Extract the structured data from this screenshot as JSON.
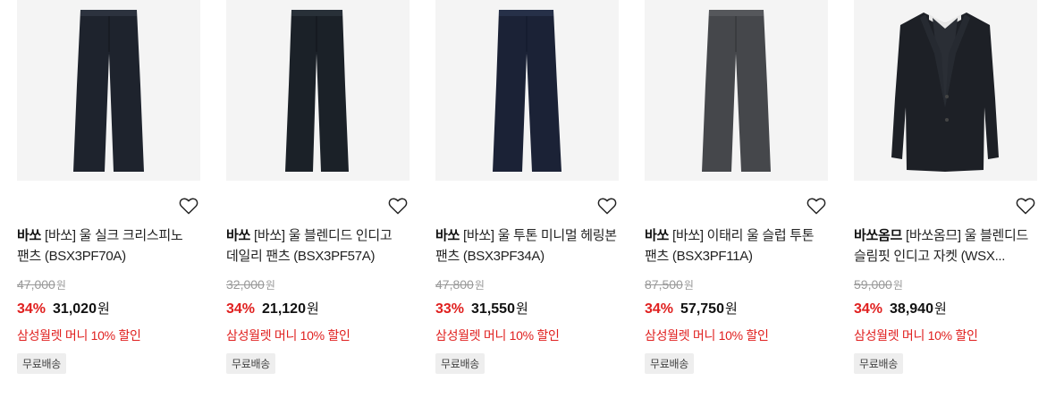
{
  "products": [
    {
      "brand": "바쏘",
      "name": "[바쏘] 울 실크 크리스피노 팬츠 (BSX3PF70A)",
      "original_price": "47,000",
      "discount_rate": "34%",
      "sale_price": "31,020",
      "currency": "원",
      "promo": "삼성월렛 머니 10% 할인",
      "badge": "무료배송",
      "image": "pants",
      "garment_color": "#1e232d"
    },
    {
      "brand": "바쏘",
      "name": "[바쏘] 울 블렌디드 인디고 데일리 팬츠 (BSX3PF57A)",
      "original_price": "32,000",
      "discount_rate": "34%",
      "sale_price": "21,120",
      "currency": "원",
      "promo": "삼성월렛 머니 10% 할인",
      "badge": "무료배송",
      "image": "pants",
      "garment_color": "#1b2128"
    },
    {
      "brand": "바쏘",
      "name": "[바쏘] 울 투톤 미니멀 헤링본 팬츠 (BSX3PF34A)",
      "original_price": "47,800",
      "discount_rate": "33%",
      "sale_price": "31,550",
      "currency": "원",
      "promo": "삼성월렛 머니 10% 할인",
      "badge": "무료배송",
      "image": "pants",
      "garment_color": "#1b2236"
    },
    {
      "brand": "바쏘",
      "name": "[바쏘] 이태리 울 슬럽 투톤 팬츠 (BSX3PF11A)",
      "original_price": "87,500",
      "discount_rate": "34%",
      "sale_price": "57,750",
      "currency": "원",
      "promo": "삼성월렛 머니 10% 할인",
      "badge": "무료배송",
      "image": "pants",
      "garment_color": "#45474b"
    },
    {
      "brand": "바쏘옴므",
      "name": "[바쏘옴므] 울 블렌디드 슬림핏 인디고 자켓 (WSX...",
      "original_price": "59,000",
      "discount_rate": "34%",
      "sale_price": "38,940",
      "currency": "원",
      "promo": "삼성월렛 머니 10% 할인",
      "badge": "무료배송",
      "image": "jacket",
      "garment_color": "#1d2026"
    }
  ]
}
